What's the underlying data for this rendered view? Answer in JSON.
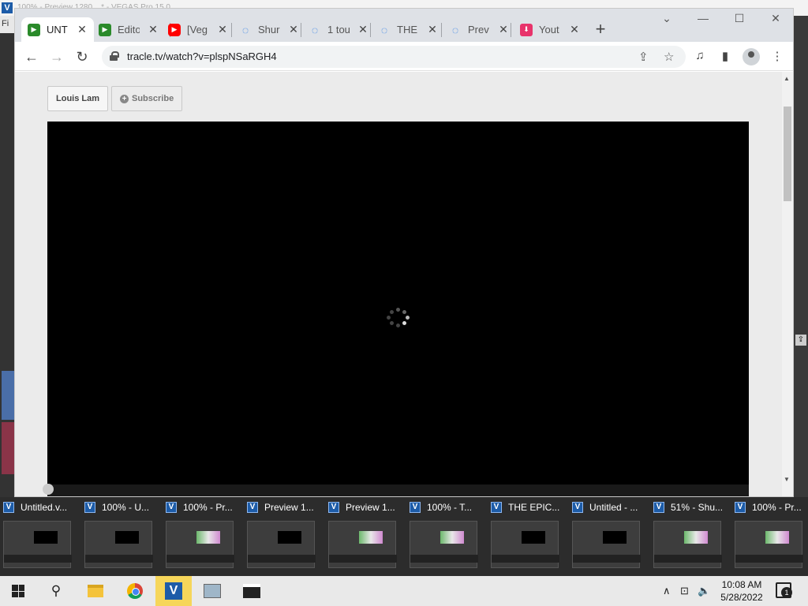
{
  "background_app": {
    "logo": "V",
    "title": "100% - Preview 1280... * - VEGAS Pro 15.0",
    "menu_letter": "Fi"
  },
  "browser": {
    "tabs": [
      {
        "label": "UNT",
        "favicon": "green-play-icon",
        "active": true
      },
      {
        "label": "Edito",
        "favicon": "green-play-icon"
      },
      {
        "label": "[Veg",
        "favicon": "youtube-icon"
      },
      {
        "label": "Shur",
        "favicon": "loading-icon"
      },
      {
        "label": "1 tou",
        "favicon": "loading-icon"
      },
      {
        "label": "THE",
        "favicon": "loading-icon"
      },
      {
        "label": "Prev",
        "favicon": "loading-icon"
      },
      {
        "label": "Yout",
        "favicon": "download-icon"
      }
    ],
    "new_tab": "+",
    "url": "tracle.tv/watch?v=plspNSaRGH4",
    "glyphs": {
      "close": "✕",
      "back": "←",
      "forward": "→",
      "reload": "↻",
      "share": "⇪",
      "star": "☆",
      "media": "♫",
      "sidebar": "▮",
      "menu": "⋮",
      "minimize": "—",
      "maximize": "☐",
      "tab_search": "⌄",
      "play": "▶",
      "download": "⬇",
      "spinner": "◌",
      "scroll_up": "▲",
      "scroll_down": "▼"
    }
  },
  "page": {
    "channel_button": "Louis Lam",
    "subscribe_button": "Subscribe",
    "subscribe_icon": "+",
    "progress": 0.0
  },
  "task_view": [
    {
      "label": "Untitled.v...",
      "thumb": "dark"
    },
    {
      "label": "100% - U...",
      "thumb": "dark"
    },
    {
      "label": "100% - Pr...",
      "thumb": "color"
    },
    {
      "label": "Preview 1...",
      "thumb": "dark"
    },
    {
      "label": "Preview 1...",
      "thumb": "color"
    },
    {
      "label": "100% - T...",
      "thumb": "color"
    },
    {
      "label": "THE EPIC...",
      "thumb": "dark"
    },
    {
      "label": "Untitled - ...",
      "thumb": "dark"
    },
    {
      "label": "51% - Shu...",
      "thumb": "color"
    },
    {
      "label": "100% - Pr...",
      "thumb": "color"
    }
  ],
  "task_view_badge": "V",
  "taskbar": {
    "time": "10:08 AM",
    "date": "5/28/2022",
    "notification_count": "1",
    "search_glyph": "⚲",
    "tray_glyphs": {
      "chevron": "∧",
      "network": "⊡",
      "volume": "🔈"
    },
    "vegas_logo": "V"
  }
}
